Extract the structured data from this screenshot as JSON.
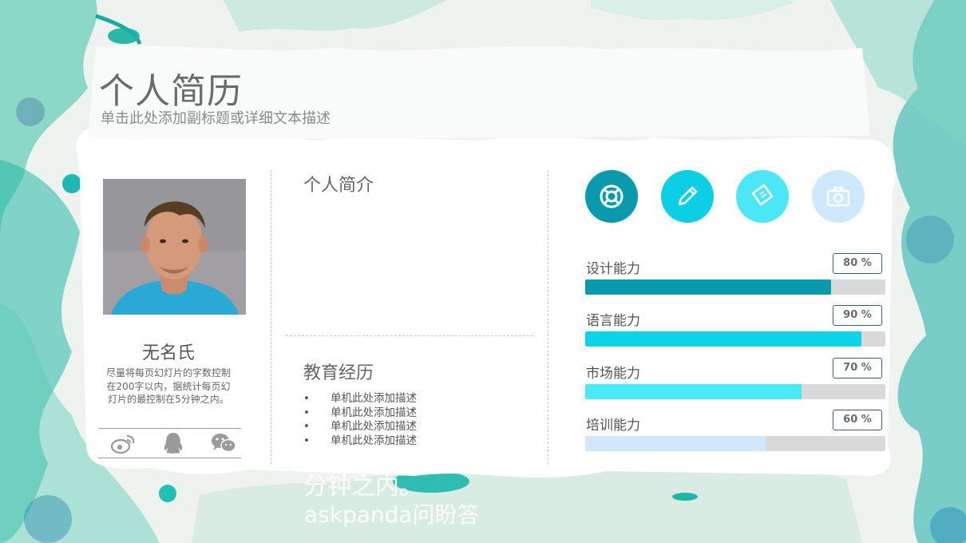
{
  "slide": {
    "title": "个人简历",
    "subtitle": "单击此处添加副标题或详细文本描述"
  },
  "profile": {
    "name": "无名氏",
    "description": "尽量将每页幻灯片的字数控制在200字以内，据统计每页幻灯片的最控制在5分钟之内。",
    "social_icons": [
      "weibo-icon",
      "qq-icon",
      "wechat-icon"
    ]
  },
  "intro": {
    "heading": "个人简介"
  },
  "education": {
    "heading": "教育经历",
    "items": [
      "单机此处添加描述",
      "单机此处添加描述",
      "单机此处添加描述",
      "单机此处添加描述"
    ]
  },
  "skill_icons": [
    {
      "icon": "lifebuoy-icon",
      "color": "#0a9aad"
    },
    {
      "icon": "pencil-icon",
      "color": "#0ccfe6"
    },
    {
      "icon": "ticket-icon",
      "color": "#4ce7f7"
    },
    {
      "icon": "camera-icon",
      "color": "#cde9fb"
    }
  ],
  "skills": [
    {
      "label": "设计能力",
      "percent_text": "80 %",
      "level": 0.82,
      "color": "#0a9aad"
    },
    {
      "label": "语言能力",
      "percent_text": "90 %",
      "level": 0.92,
      "color": "#0bd3e8"
    },
    {
      "label": "市场能力",
      "percent_text": "70 %",
      "level": 0.72,
      "color": "#4ae9f8"
    },
    {
      "label": "培训能力",
      "percent_text": "60 %",
      "level": 0.6,
      "color": "#cfe8fa"
    }
  ],
  "watermark": {
    "line1": "分钟之内。",
    "line2": "askpanda问盼答"
  }
}
